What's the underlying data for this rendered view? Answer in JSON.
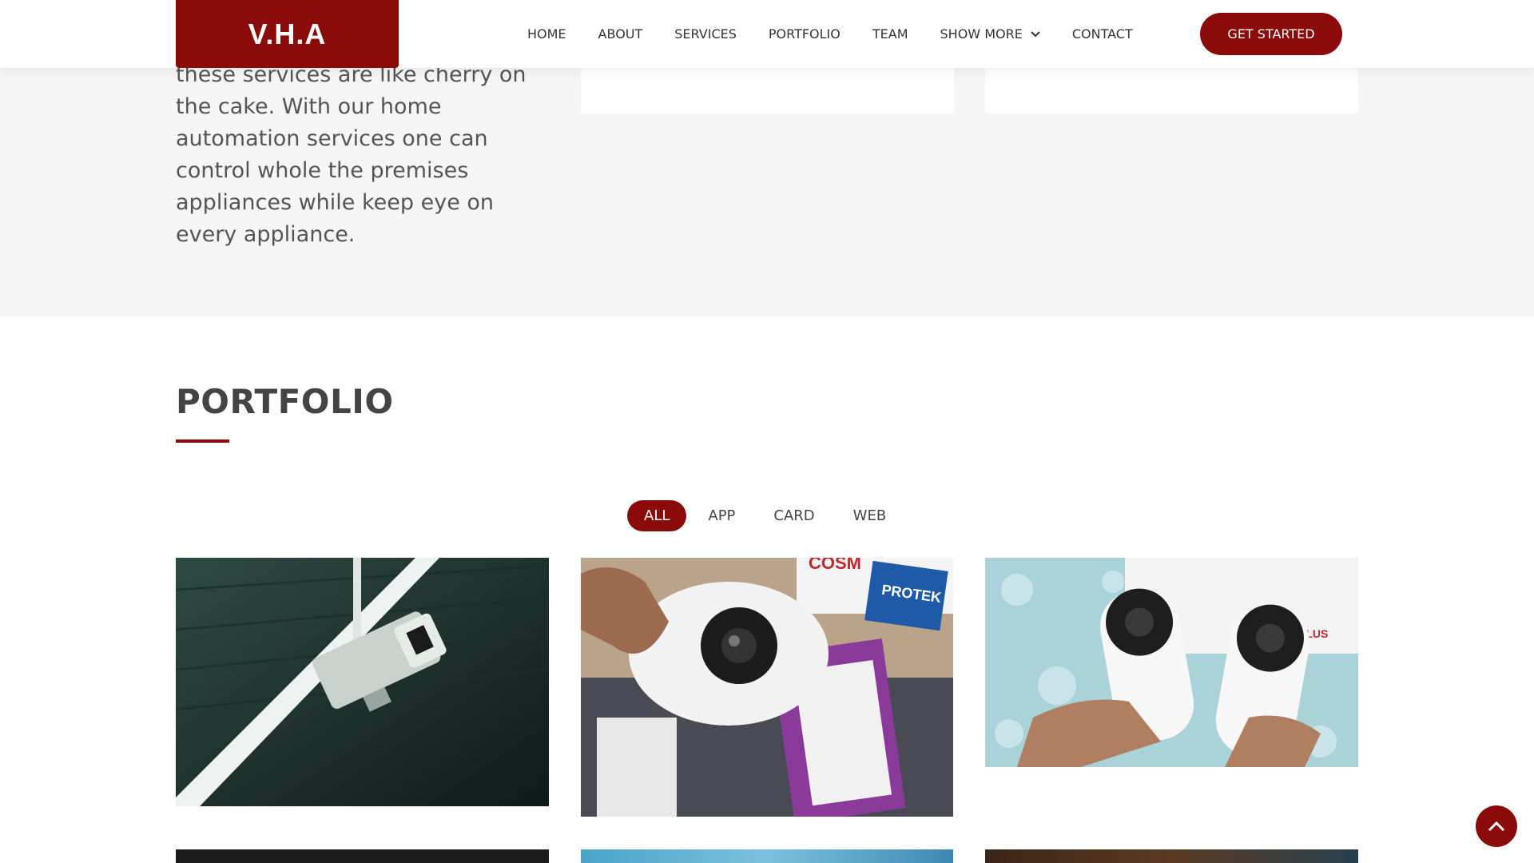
{
  "brand": {
    "logo_text": "V.H.A",
    "accent_color": "#8b0a0a"
  },
  "nav": {
    "items": [
      {
        "label": "HOME"
      },
      {
        "label": "ABOUT"
      },
      {
        "label": "SERVICES"
      },
      {
        "label": "PORTFOLIO"
      },
      {
        "label": "TEAM"
      },
      {
        "label": "SHOW MORE",
        "icon": "chevron-down-icon"
      },
      {
        "label": "CONTACT"
      }
    ],
    "cta_label": "GET STARTED"
  },
  "about": {
    "text": "these services are like cherry on the cake. With our home automation services one can control whole the premises appliances while keep eye on every appliance."
  },
  "portfolio": {
    "title": "PORTFOLIO",
    "filters": [
      {
        "label": "ALL",
        "active": true
      },
      {
        "label": "APP",
        "active": false
      },
      {
        "label": "CARD",
        "active": false
      },
      {
        "label": "WEB",
        "active": false
      }
    ],
    "tiles": [
      {
        "image": "ceiling-mounted-cctv-camera-photo"
      },
      {
        "image": "dome-camera-in-hand-with-boxes-photo"
      },
      {
        "image": "two-bullet-cameras-in-hands-photo"
      },
      {
        "image": "portfolio-image-4"
      },
      {
        "image": "portfolio-image-5"
      },
      {
        "image": "portfolio-image-6"
      }
    ],
    "box_labels": {
      "cosmo": "COSM",
      "protek": "PROTEK",
      "plus": "PLUS"
    }
  },
  "back_to_top_icon": "chevron-up-icon"
}
